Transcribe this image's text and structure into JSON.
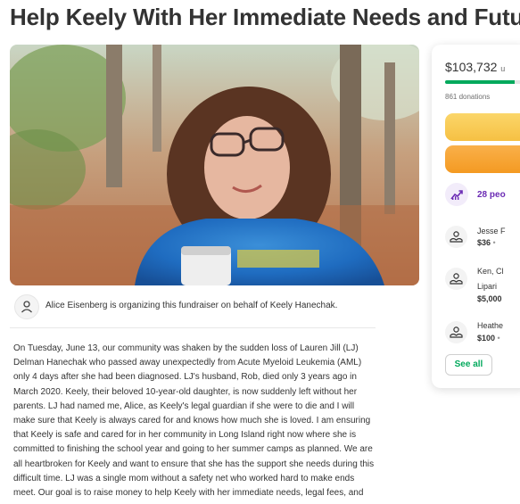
{
  "page": {
    "title": "Help Keely With Her Immediate Needs and Future"
  },
  "organizer": {
    "text": "Alice Eisenberg is organizing this fundraiser on behalf of Keely Hanechak."
  },
  "story": {
    "text": "On Tuesday, June 13, our community was shaken by the sudden loss of Lauren Jill (LJ) Delman Hanechak who passed away unexpectedly from Acute Myeloid Leukemia (AML) only 4 days after she had been diagnosed. LJ's husband, Rob, died only 3 years ago in March 2020. Keely, their beloved 10-year-old daughter, is now suddenly left without her parents. LJ had named me, Alice, as Keely's legal guardian if she were to die and I will make sure that Keely is always cared for and knows how much she is loved. I am ensuring that Keely is safe and cared for in her community in Long Island right now where she is committed to finishing the school year and going to her summer camps as planned. We are all heartbroken for Keely and want to ensure that she has the support she needs during this difficult time. LJ was a single mom without a safety net who worked hard to make ends meet. Our goal is to raise money to help Keely with her immediate needs, legal fees, and"
  },
  "donation_card": {
    "amount_raised": "$103,732",
    "raised_suffix": "u",
    "progress": 0.82,
    "donations_count": "861 donations",
    "trend_text": "28 peo",
    "donors": [
      {
        "name": "Jesse F",
        "amount": "$36",
        "sep": "•"
      },
      {
        "name": "Ken, Cl",
        "name2": "Lipari",
        "amount": "$5,000",
        "sep": ""
      },
      {
        "name": "Heathe",
        "amount": "$100",
        "sep": "•"
      }
    ],
    "see_all_label": "See all"
  },
  "colors": {
    "accent_green": "#02a95c",
    "share_yellow": "#f6c043",
    "donate_orange": "#f49a22",
    "trend_purple": "#6b2bb4"
  },
  "icons": {
    "organizer": "person-icon",
    "trend": "trending-up-icon",
    "donor": "donation-hands-icon"
  }
}
